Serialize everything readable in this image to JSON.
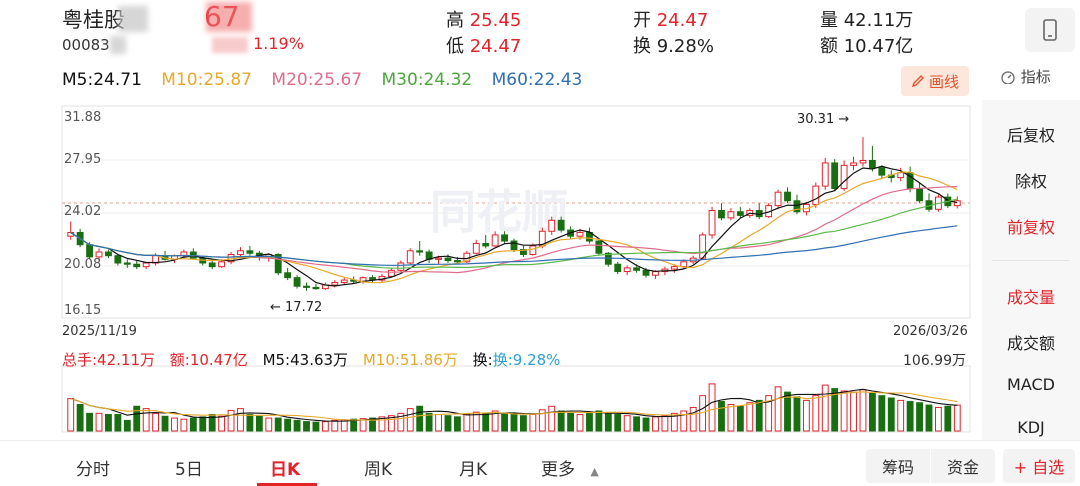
{
  "stock": {
    "name": "粤桂股",
    "code": "00083",
    "price": "67",
    "change_pct": "1.19%"
  },
  "stats": {
    "high_label": "高",
    "high": "25.45",
    "open_label": "开",
    "open": "24.47",
    "volume_label": "量",
    "volume": "42.11万",
    "low_label": "低",
    "low": "24.47",
    "turnover_label": "换",
    "turnover": "9.28%",
    "amount_label": "额",
    "amount": "10.47亿"
  },
  "ma": {
    "m5": "M5:24.71",
    "m10": "M10:25.87",
    "m20": "M20:25.67",
    "m30": "M30:24.32",
    "m60": "M60:22.43"
  },
  "toolbar": {
    "draw_label": "画线",
    "indicator_label": "指标"
  },
  "side_menu": [
    "后复权",
    "除权",
    "前复权",
    "成交量",
    "成交额",
    "MACD",
    "KDJ"
  ],
  "side_active": "前复权",
  "vol_info": {
    "total": "总手:42.11万",
    "amount": "额:10.47亿",
    "m5": "M5:43.63万",
    "m10": "M10:51.86万",
    "turnover": "换:9.28%",
    "max": "106.99万"
  },
  "bottom_tabs": [
    "分时",
    "5日",
    "日K",
    "周K",
    "月K",
    "更多"
  ],
  "bottom_active": "日K",
  "bottom_buttons": {
    "chips": "筹码",
    "funds": "资金",
    "add": "+ 自选"
  },
  "colors": {
    "up": "#e2232a",
    "down": "#1a6e12",
    "m5": "#111111",
    "m10": "#e8a92a",
    "m20": "#e06c8a",
    "m30": "#5cbb4a",
    "m60": "#2f6fb4"
  },
  "chart_data": {
    "type": "candlestick",
    "x_start": "2025/11/19",
    "x_end": "2026/03/26",
    "y_ticks": [
      "31.88",
      "27.95",
      "24.02",
      "20.08",
      "16.15"
    ],
    "ylim": [
      16.15,
      31.88
    ],
    "annotations": {
      "high": "30.31",
      "low": "17.72"
    },
    "candles": [
      [
        22.2,
        23.4,
        21.9,
        22.5
      ],
      [
        22.5,
        22.8,
        21.3,
        21.5
      ],
      [
        21.5,
        21.7,
        20.3,
        20.5
      ],
      [
        20.5,
        21.2,
        20.2,
        20.9
      ],
      [
        20.9,
        21.1,
        20.4,
        20.6
      ],
      [
        20.6,
        20.7,
        19.8,
        20.0
      ],
      [
        20.0,
        20.3,
        19.6,
        19.9
      ],
      [
        19.9,
        20.2,
        19.5,
        19.7
      ],
      [
        19.7,
        20.1,
        19.5,
        20.0
      ],
      [
        20.0,
        20.8,
        19.8,
        20.6
      ],
      [
        20.6,
        21.0,
        20.2,
        20.3
      ],
      [
        20.3,
        20.7,
        20.0,
        20.6
      ],
      [
        20.6,
        21.1,
        20.4,
        20.9
      ],
      [
        20.9,
        21.2,
        20.3,
        20.4
      ],
      [
        20.4,
        20.6,
        19.8,
        20.0
      ],
      [
        20.0,
        20.2,
        19.5,
        19.7
      ],
      [
        19.7,
        20.3,
        19.6,
        20.1
      ],
      [
        20.1,
        20.9,
        19.9,
        20.7
      ],
      [
        20.7,
        21.3,
        20.5,
        21.0
      ],
      [
        21.0,
        21.4,
        20.6,
        20.8
      ],
      [
        20.8,
        21.0,
        20.2,
        20.5
      ],
      [
        20.5,
        20.8,
        20.1,
        20.7
      ],
      [
        20.7,
        20.8,
        19.0,
        19.2
      ],
      [
        19.2,
        19.6,
        18.6,
        18.8
      ],
      [
        18.8,
        19.0,
        17.9,
        18.1
      ],
      [
        18.1,
        18.4,
        17.72,
        18.0
      ],
      [
        18.0,
        18.3,
        17.8,
        17.9
      ],
      [
        17.9,
        18.4,
        17.8,
        18.2
      ],
      [
        18.2,
        18.6,
        18.0,
        18.4
      ],
      [
        18.4,
        18.8,
        18.2,
        18.6
      ],
      [
        18.6,
        18.9,
        18.3,
        18.5
      ],
      [
        18.5,
        18.9,
        18.3,
        18.8
      ],
      [
        18.8,
        19.0,
        18.4,
        18.6
      ],
      [
        18.6,
        19.1,
        18.4,
        18.9
      ],
      [
        18.9,
        19.6,
        18.8,
        19.4
      ],
      [
        19.4,
        20.2,
        19.2,
        20.0
      ],
      [
        20.0,
        21.2,
        19.9,
        21.0
      ],
      [
        21.0,
        21.8,
        20.6,
        20.9
      ],
      [
        20.9,
        21.1,
        20.0,
        20.3
      ],
      [
        20.3,
        20.6,
        19.9,
        20.4
      ],
      [
        20.4,
        20.7,
        20.0,
        20.2
      ],
      [
        20.2,
        20.5,
        19.9,
        20.1
      ],
      [
        20.1,
        21.0,
        20.0,
        20.8
      ],
      [
        20.8,
        21.9,
        20.7,
        21.6
      ],
      [
        21.6,
        22.3,
        21.2,
        21.4
      ],
      [
        21.4,
        22.6,
        21.3,
        22.3
      ],
      [
        22.3,
        22.6,
        21.6,
        21.8
      ],
      [
        21.8,
        22.0,
        20.9,
        21.1
      ],
      [
        21.1,
        21.4,
        20.5,
        20.7
      ],
      [
        20.7,
        21.6,
        20.6,
        21.4
      ],
      [
        21.4,
        22.9,
        21.2,
        22.6
      ],
      [
        22.6,
        23.8,
        22.3,
        23.5
      ],
      [
        23.5,
        23.8,
        22.5,
        22.7
      ],
      [
        22.7,
        23.0,
        22.0,
        22.2
      ],
      [
        22.2,
        22.8,
        21.9,
        22.5
      ],
      [
        22.5,
        22.9,
        21.6,
        21.8
      ],
      [
        21.8,
        22.0,
        20.6,
        20.8
      ],
      [
        20.8,
        20.9,
        19.7,
        19.9
      ],
      [
        19.9,
        20.1,
        19.1,
        19.3
      ],
      [
        19.3,
        19.8,
        19.0,
        19.6
      ],
      [
        19.6,
        19.9,
        19.2,
        19.4
      ],
      [
        19.4,
        19.6,
        18.8,
        19.0
      ],
      [
        19.0,
        19.4,
        18.7,
        19.3
      ],
      [
        19.3,
        19.7,
        19.0,
        19.5
      ],
      [
        19.5,
        19.9,
        19.2,
        19.7
      ],
      [
        19.7,
        20.3,
        19.5,
        20.1
      ],
      [
        20.1,
        20.6,
        19.9,
        20.4
      ],
      [
        20.4,
        22.5,
        20.3,
        22.3
      ],
      [
        22.3,
        24.6,
        22.0,
        24.3
      ],
      [
        24.3,
        24.9,
        23.5,
        23.7
      ],
      [
        23.7,
        24.5,
        23.5,
        24.2
      ],
      [
        24.2,
        24.6,
        23.7,
        23.9
      ],
      [
        23.9,
        24.5,
        23.7,
        24.3
      ],
      [
        24.3,
        24.9,
        23.6,
        23.8
      ],
      [
        23.8,
        24.9,
        23.7,
        24.7
      ],
      [
        24.7,
        26.0,
        24.4,
        25.8
      ],
      [
        25.8,
        26.2,
        24.9,
        25.1
      ],
      [
        25.1,
        25.6,
        24.0,
        24.2
      ],
      [
        24.2,
        25.0,
        23.9,
        24.8
      ],
      [
        24.8,
        26.6,
        24.5,
        26.3
      ],
      [
        26.3,
        28.6,
        26.0,
        28.2
      ],
      [
        28.2,
        28.5,
        25.9,
        26.1
      ],
      [
        26.1,
        28.4,
        25.9,
        28.0
      ],
      [
        28.0,
        28.7,
        27.6,
        28.2
      ],
      [
        28.2,
        30.31,
        27.9,
        28.4
      ],
      [
        28.4,
        29.6,
        27.5,
        27.8
      ],
      [
        27.8,
        28.0,
        26.9,
        27.2
      ],
      [
        27.2,
        27.6,
        26.6,
        27.0
      ],
      [
        27.0,
        27.8,
        26.7,
        27.4
      ],
      [
        27.4,
        27.9,
        25.8,
        26.1
      ],
      [
        26.1,
        26.6,
        24.9,
        25.1
      ],
      [
        25.1,
        25.7,
        24.2,
        24.4
      ],
      [
        24.4,
        25.6,
        24.2,
        25.4
      ],
      [
        25.4,
        25.7,
        24.5,
        24.7
      ],
      [
        24.7,
        25.45,
        24.47,
        25.1
      ]
    ],
    "volumes": [
      55,
      45,
      30,
      30,
      28,
      28,
      18,
      42,
      38,
      30,
      25,
      22,
      20,
      22,
      24,
      28,
      25,
      35,
      38,
      28,
      25,
      22,
      22,
      20,
      18,
      16,
      15,
      16,
      18,
      19,
      20,
      21,
      22,
      24,
      26,
      30,
      38,
      42,
      30,
      28,
      26,
      24,
      28,
      32,
      30,
      34,
      30,
      28,
      26,
      28,
      36,
      42,
      34,
      30,
      28,
      30,
      34,
      30,
      28,
      26,
      24,
      22,
      24,
      26,
      30,
      34,
      40,
      60,
      80,
      50,
      45,
      42,
      48,
      52,
      60,
      75,
      66,
      58,
      52,
      60,
      78,
      72,
      68,
      66,
      70,
      64,
      60,
      56,
      52,
      50,
      48,
      44,
      40,
      42,
      44
    ],
    "volume_max": 106.99
  }
}
